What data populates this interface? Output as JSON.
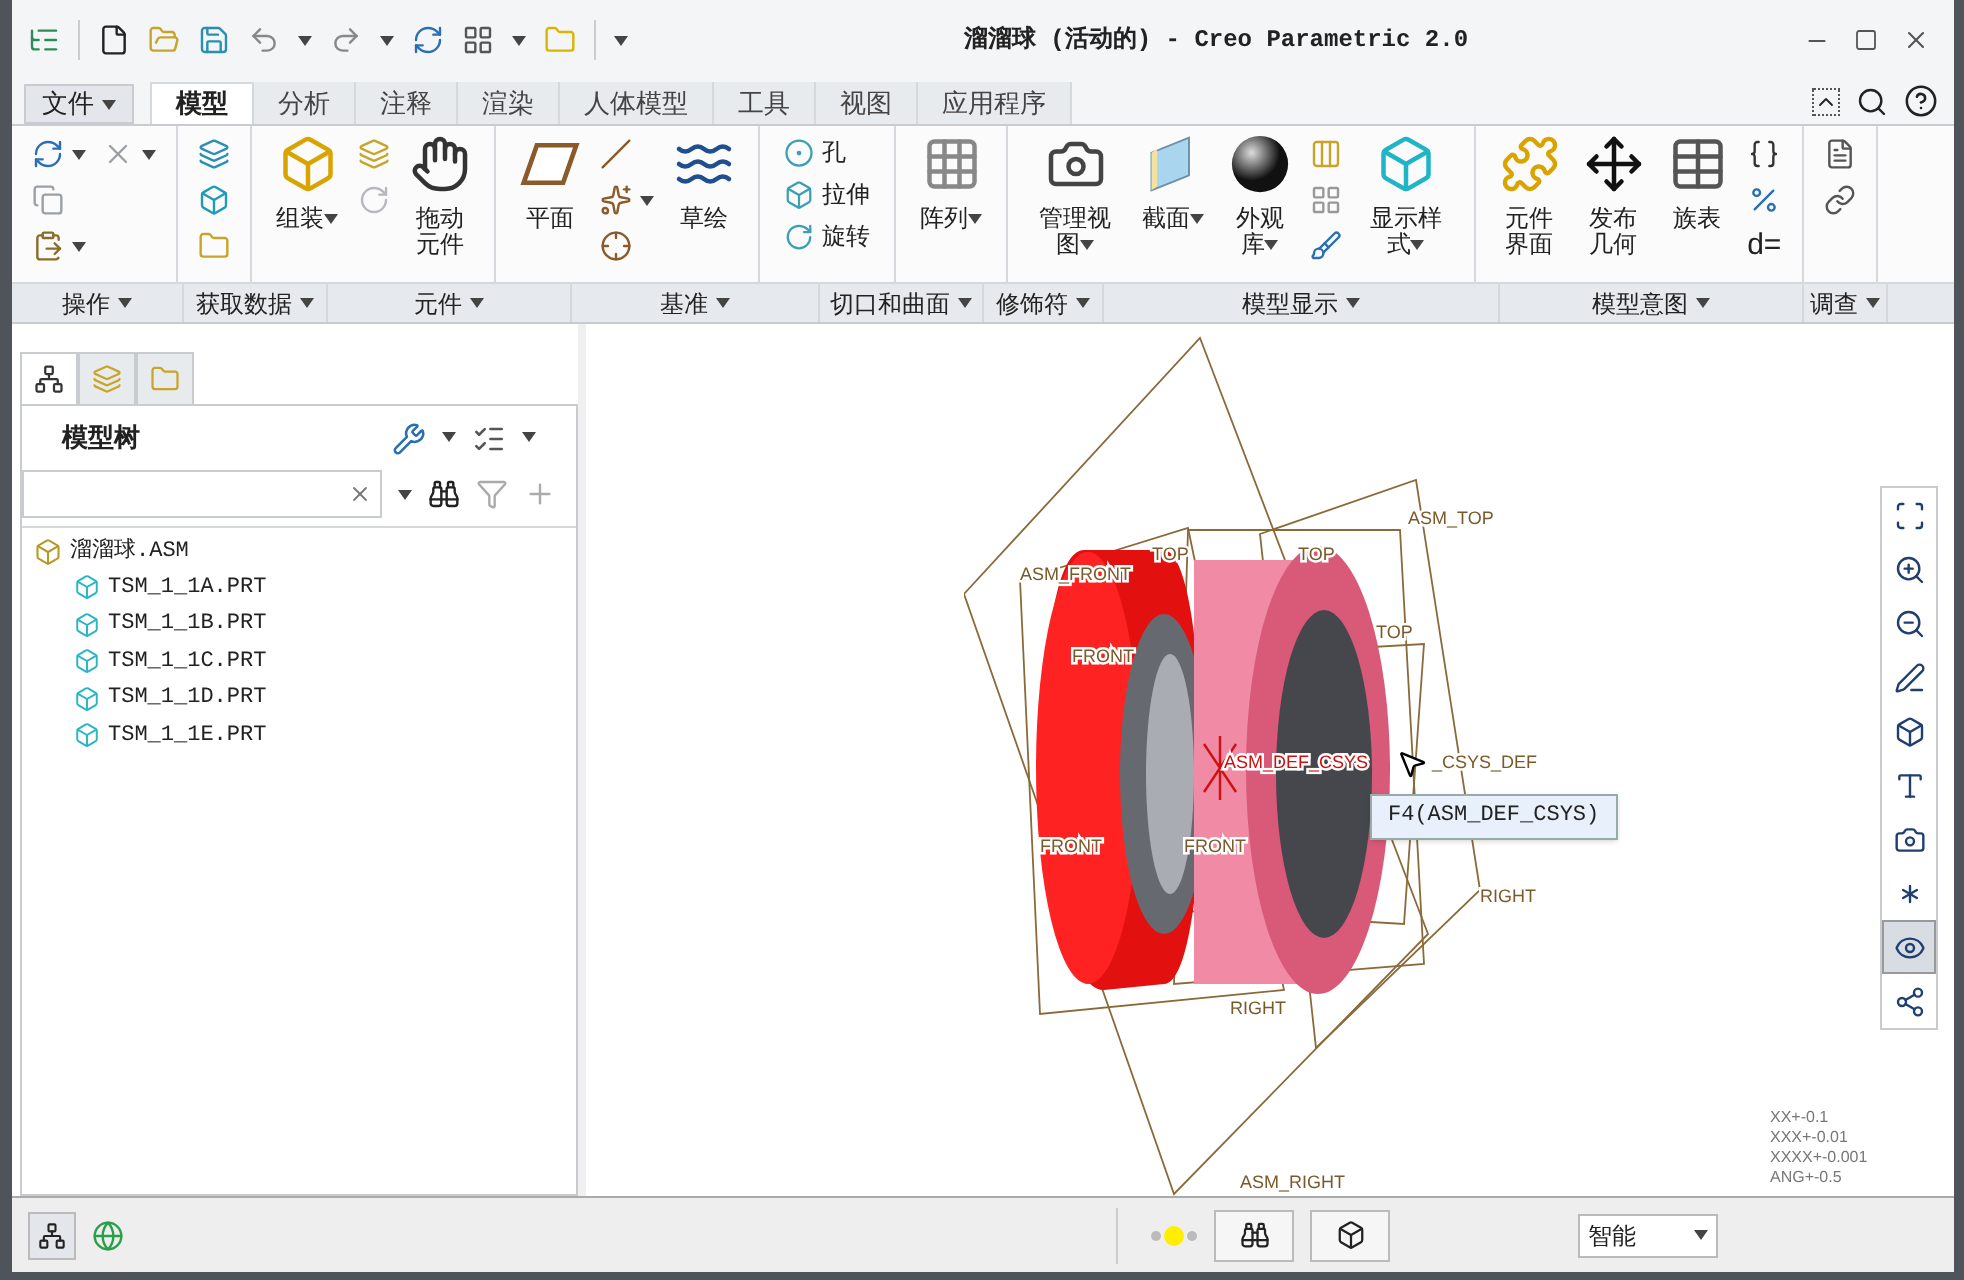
{
  "window": {
    "title": "溜溜球 (活动的) - Creo Parametric 2.0"
  },
  "tabs": [
    {
      "kind": "file",
      "label": "文件",
      "selected": false
    },
    {
      "kind": "tab",
      "label": "模型",
      "selected": true
    },
    {
      "kind": "tab",
      "label": "分析",
      "selected": false
    },
    {
      "kind": "tab",
      "label": "注释",
      "selected": false
    },
    {
      "kind": "tab",
      "label": "渲染",
      "selected": false
    },
    {
      "kind": "tab",
      "label": "人体模型",
      "selected": false
    },
    {
      "kind": "tab",
      "label": "工具",
      "selected": false
    },
    {
      "kind": "tab",
      "label": "视图",
      "selected": false
    },
    {
      "kind": "tab",
      "label": "应用程序",
      "selected": false
    }
  ],
  "ribbon_groups": [
    {
      "label": "操作",
      "columns": [
        [
          {
            "kind": "icon",
            "dropdown": true
          },
          {
            "kind": "icon",
            "dropdown": false
          },
          {
            "kind": "icon",
            "dropdown": true
          }
        ],
        [
          {
            "kind": "icon",
            "dropdown": true
          }
        ]
      ]
    },
    {
      "label": "获取数据",
      "columns": [
        [
          {
            "kind": "icon",
            "dropdown": false
          },
          {
            "kind": "icon",
            "dropdown": false
          },
          {
            "kind": "icon",
            "dropdown": false
          }
        ]
      ]
    },
    {
      "label": "元件",
      "columns": [
        [
          {
            "kind": "large",
            "label": "组装",
            "dropdown": true
          }
        ],
        [
          {
            "kind": "icon",
            "dropdown": false
          },
          {
            "kind": "icon",
            "dropdown": false
          }
        ],
        [
          {
            "kind": "large",
            "label": "拖动元件",
            "dropdown": false
          }
        ]
      ]
    },
    {
      "label": "基准",
      "columns": [
        [
          {
            "kind": "large",
            "label": "平面",
            "dropdown": false
          }
        ],
        [
          {
            "kind": "icon",
            "dropdown": false
          },
          {
            "kind": "icon",
            "dropdown": true
          },
          {
            "kind": "icon",
            "dropdown": false
          }
        ],
        [
          {
            "kind": "large",
            "label": "草绘",
            "dropdown": false
          }
        ]
      ]
    },
    {
      "label": "切口和曲面",
      "columns": [
        [
          {
            "kind": "small",
            "label": "孔",
            "dropdown": false
          },
          {
            "kind": "small",
            "label": "拉伸",
            "dropdown": false
          },
          {
            "kind": "small",
            "label": "旋转",
            "dropdown": false
          }
        ]
      ]
    },
    {
      "label": "修饰符",
      "columns": [
        [
          {
            "kind": "large",
            "label": "阵列",
            "dropdown": true
          }
        ]
      ]
    },
    {
      "label": "模型显示",
      "columns": [
        [
          {
            "kind": "large",
            "label": "管理视图",
            "dropdown": true
          }
        ],
        [
          {
            "kind": "large",
            "label": "截面",
            "dropdown": true
          }
        ],
        [
          {
            "kind": "large",
            "label": "外观库",
            "dropdown": true
          }
        ],
        [
          {
            "kind": "icon",
            "dropdown": false
          },
          {
            "kind": "icon",
            "dropdown": false
          },
          {
            "kind": "icon",
            "dropdown": false
          }
        ],
        [
          {
            "kind": "large",
            "label": "显示样式",
            "dropdown": true
          }
        ]
      ]
    },
    {
      "label": "模型意图",
      "columns": [
        [
          {
            "kind": "large",
            "label": "元件界面",
            "dropdown": false
          }
        ],
        [
          {
            "kind": "large",
            "label": "发布几何",
            "dropdown": false
          }
        ],
        [
          {
            "kind": "large",
            "label": "族表",
            "dropdown": false
          }
        ],
        [
          {
            "kind": "icon",
            "dropdown": false
          },
          {
            "kind": "icon",
            "dropdown": false
          },
          {
            "kind": "glyph",
            "label": "d=",
            "dropdown": false
          }
        ]
      ]
    },
    {
      "label": "调查",
      "columns": [
        [
          {
            "kind": "icon",
            "dropdown": false
          },
          {
            "kind": "icon",
            "dropdown": false
          }
        ]
      ]
    }
  ],
  "tree_tabs": [
    {
      "selected": true
    },
    {
      "selected": false
    },
    {
      "selected": false
    }
  ],
  "model_tree": {
    "title": "模型树",
    "root": {
      "label": "溜溜球.ASM",
      "children": [
        {
          "label": "TSM_1_1A.PRT"
        },
        {
          "label": "TSM_1_1B.PRT"
        },
        {
          "label": "TSM_1_1C.PRT"
        },
        {
          "label": "TSM_1_1D.PRT"
        },
        {
          "label": "TSM_1_1E.PRT"
        }
      ]
    }
  },
  "datum_labels": [
    {
      "label": "ASM_TOP"
    },
    {
      "label": "ASM_FRONT"
    },
    {
      "label": "TOP"
    },
    {
      "label": "TOP"
    },
    {
      "label": "TOP"
    },
    {
      "label": "FRONT"
    },
    {
      "label": "FRONT"
    },
    {
      "label": "FRONT"
    },
    {
      "label": "ASM_DEF_CSYS"
    },
    {
      "label": "_CSYS_DEF"
    },
    {
      "label": "RIGHT"
    },
    {
      "label": "RIGHT"
    },
    {
      "label": "ASM_RIGHT"
    }
  ],
  "tooltip": "F4(ASM_DEF_CSYS)",
  "view_toolbar": [
    {
      "pressed": false
    },
    {
      "pressed": false
    },
    {
      "pressed": false
    },
    {
      "pressed": false
    },
    {
      "pressed": false
    },
    {
      "pressed": false
    },
    {
      "pressed": false
    },
    {
      "pressed": false
    },
    {
      "pressed": true
    },
    {
      "pressed": false
    }
  ],
  "tolerances": [
    "XX+-0.1",
    "XXX+-0.01",
    "XXXX+-0.001",
    "ANG+-0.5"
  ],
  "status_bar": {
    "filter": "智能"
  }
}
